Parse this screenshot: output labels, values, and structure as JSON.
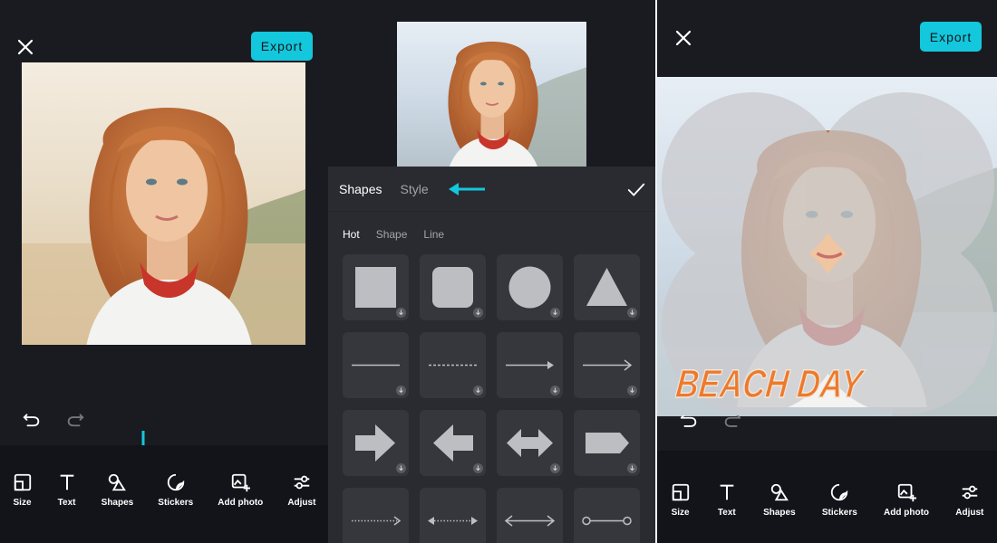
{
  "panel1": {
    "export_label": "Export",
    "toolbar": [
      {
        "name": "size",
        "label": "Size"
      },
      {
        "name": "text",
        "label": "Text"
      },
      {
        "name": "shapes",
        "label": "Shapes"
      },
      {
        "name": "stickers",
        "label": "Stickers"
      },
      {
        "name": "add-photo",
        "label": "Add photo"
      },
      {
        "name": "adjust",
        "label": "Adjust"
      }
    ]
  },
  "panel2": {
    "tabs": [
      "Shapes",
      "Style"
    ],
    "subtabs": [
      "Hot",
      "Shape",
      "Line"
    ],
    "tiles": [
      "square",
      "rounded-square",
      "circle",
      "triangle",
      "line",
      "dashed-line",
      "arrow-line",
      "thin-arrow-line",
      "arrow-right",
      "arrow-left",
      "arrow-double",
      "tag-arrow",
      "dotted-arrow",
      "dotted-double-arrow",
      "double-arrow-line",
      "dot-line"
    ]
  },
  "panel3": {
    "export_label": "Export",
    "overlay_text": "BEACH DAY",
    "toolbar": [
      {
        "name": "size",
        "label": "Size"
      },
      {
        "name": "text",
        "label": "Text"
      },
      {
        "name": "shapes",
        "label": "Shapes"
      },
      {
        "name": "stickers",
        "label": "Stickers"
      },
      {
        "name": "add-photo",
        "label": "Add photo"
      },
      {
        "name": "adjust",
        "label": "Adjust"
      }
    ]
  },
  "colors": {
    "accent": "#13c7dc",
    "overlay_text": "#ec7a2e",
    "background": "#1a1b21"
  }
}
